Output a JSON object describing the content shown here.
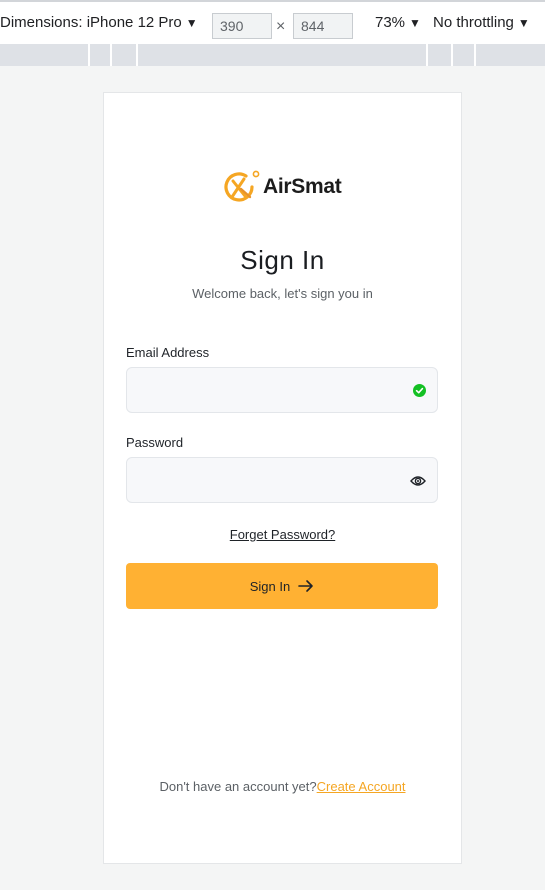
{
  "devtools": {
    "dimensions_label": "Dimensions: iPhone 12 Pro",
    "width_value": "390",
    "height_value": "844",
    "separator": "×",
    "zoom_label": "73%",
    "throttling_label": "No throttling",
    "caret": "▼"
  },
  "brand": {
    "name": "AirSmat",
    "accent_color": "#f5a623",
    "logo_icon": "airsmat-logo-icon"
  },
  "signin": {
    "title": "Sign In",
    "subtitle": "Welcome back, let's sign you in",
    "email_label": "Email Address",
    "email_value": "",
    "email_status_icon": "check-circle-icon",
    "email_status_color": "#14c024",
    "password_label": "Password",
    "password_value": "",
    "password_toggle_icon": "eye-icon",
    "forgot_password": "Forget Password?",
    "submit_label": "Sign In",
    "submit_icon": "arrow-right-icon",
    "button_color": "#ffb133"
  },
  "footer": {
    "prompt": "Don't have an account yet?",
    "create_account": "Create Account"
  }
}
